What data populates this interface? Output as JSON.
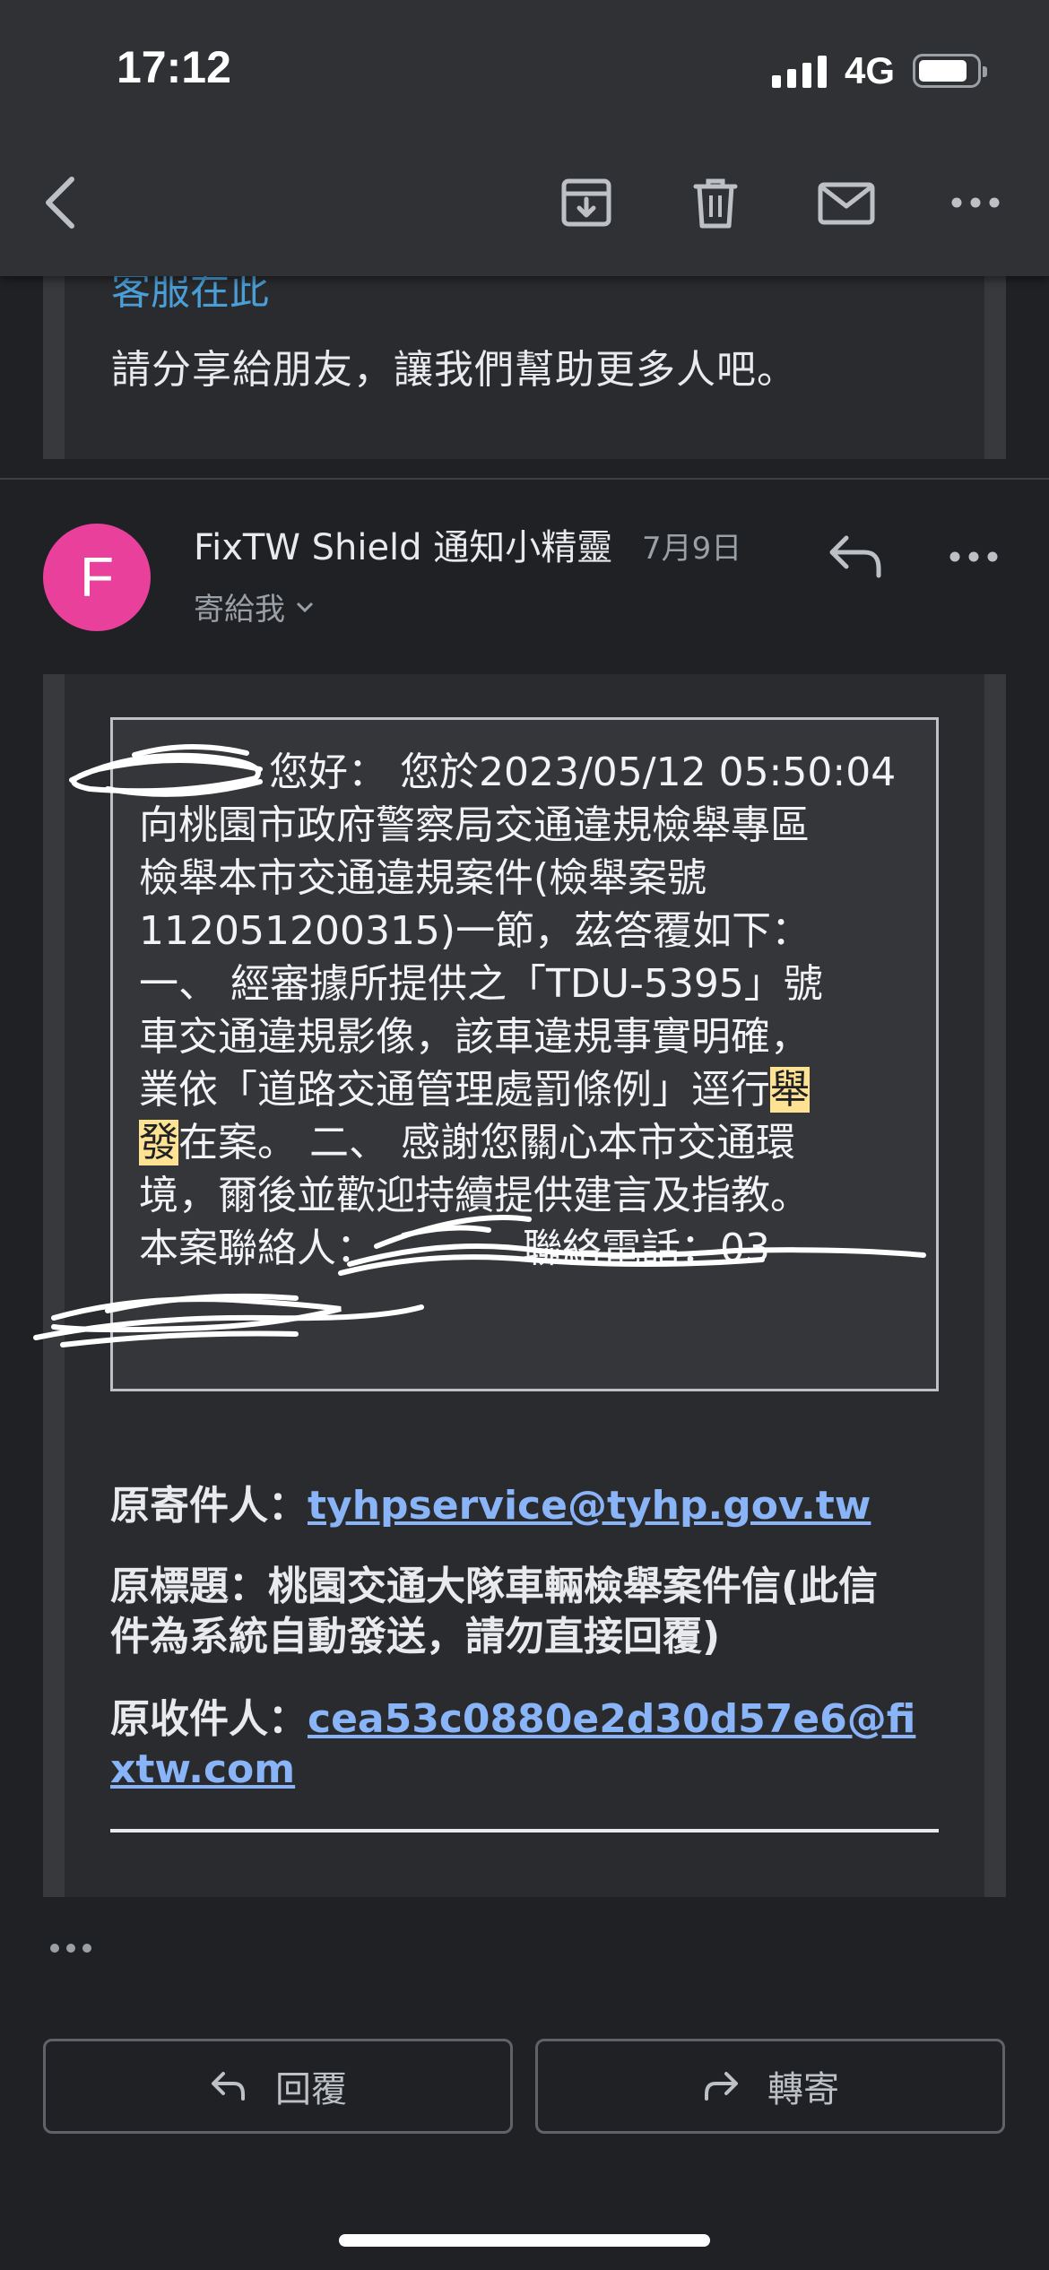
{
  "status_bar": {
    "time": "17:12",
    "network": "4G",
    "battery_level": 0.85,
    "signal_bars": 4
  },
  "toolbar": {
    "icons": [
      "back-arrow-icon",
      "archive-icon",
      "trash-icon",
      "mail-icon",
      "more-icon"
    ]
  },
  "previous_message": {
    "link_text": "客服在此",
    "share_text": "請分享給朋友，讓我們幫助更多人吧。"
  },
  "message": {
    "avatar_letter": "F",
    "avatar_color": "#e8409b",
    "sender": "FixTW Shield 通知小精靈",
    "date": "7月9日",
    "recipient_label": "寄給我",
    "body": {
      "line1": "您好： 您於2023/05/12 05:50:04",
      "line2": "向桃園市政府警察局交通違規檢舉專區",
      "line3": "檢舉本市交通違規案件(檢舉案號",
      "line4": "112051200315)一節，茲答覆如下：",
      "line5": "一、 經審據所提供之「TDU-5395」號",
      "line6": "車交通違規影像，該車違規事實明確，",
      "line7a": "業依「道路交通管理處罰條例」逕行",
      "line7hl": "舉",
      "line8hl": "發",
      "line8b": "在案。 二、 感謝您關心本市交通環",
      "line9": "境，爾後並歡迎持續提供建言及指教。",
      "line10a": "本案聯絡人：",
      "line10b": " 聯絡電話：03-"
    },
    "original_sender_label": "原寄件人：",
    "original_sender_email": "tyhpservice@tyhp.gov.tw",
    "original_subject_label": "原標題：",
    "original_subject": "桃園交通大隊車輛檢舉案件信(此信件為系統自動發送，請勿直接回覆)",
    "original_recipient_label": "原收件人：",
    "original_recipient_email": "cea53c0880e2d30d57e6@fixtw.com"
  },
  "actions": {
    "reply": "回覆",
    "forward": "轉寄"
  },
  "colors": {
    "background": "#202124",
    "link": "#8ab4f8",
    "highlight": "#fde293"
  }
}
